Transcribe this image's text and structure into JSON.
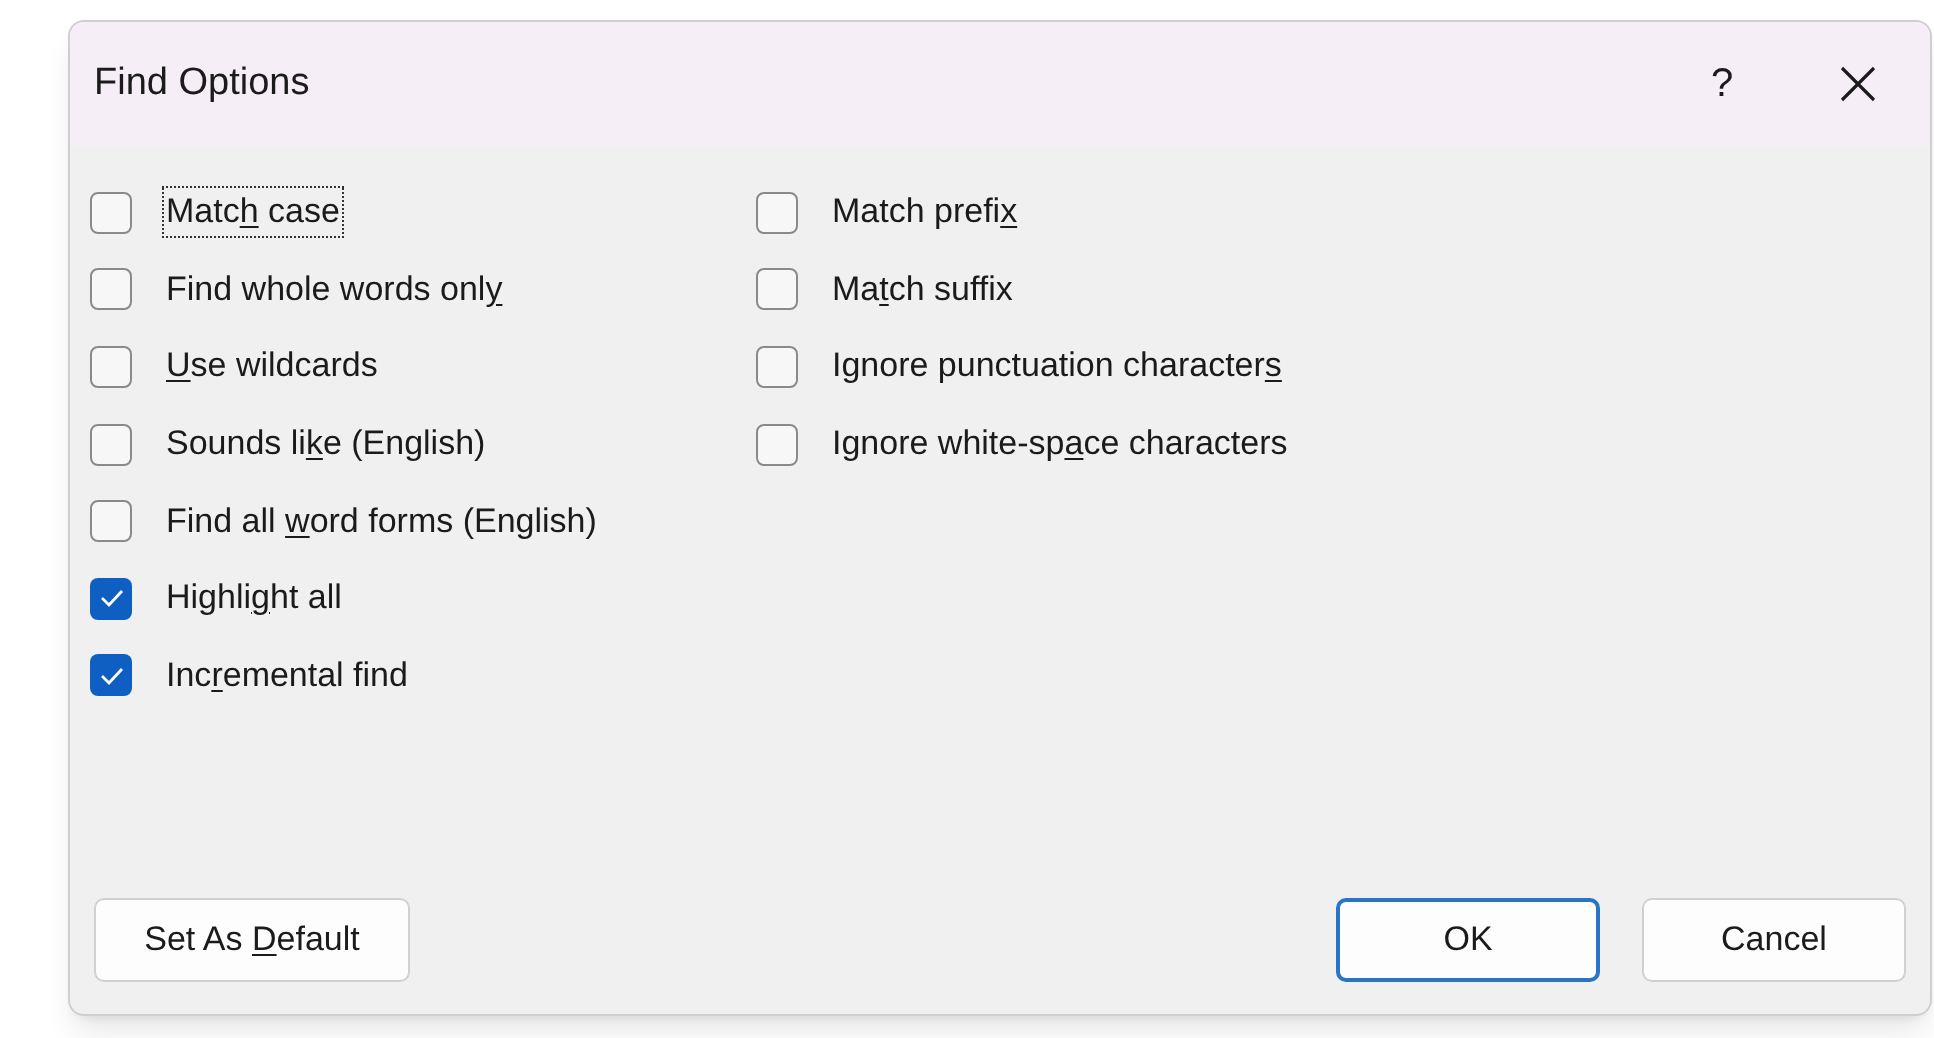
{
  "window": {
    "title": "Find Options",
    "help": "?"
  },
  "options_left": [
    {
      "before": "Matc",
      "key": "h",
      "after": " case",
      "checked": false,
      "focused": true
    },
    {
      "before": "Find whole words onl",
      "key": "y",
      "checked": false,
      "focused": false
    },
    {
      "key": "U",
      "after": "se wildcards",
      "checked": false,
      "focused": false
    },
    {
      "before": "Sounds li",
      "key": "k",
      "after": "e (English)",
      "checked": false,
      "focused": false
    },
    {
      "before": "Find all ",
      "key": "w",
      "after": "ord forms (English)",
      "checked": false,
      "focused": false
    },
    {
      "before": "Highli",
      "key": "g",
      "after": "ht all",
      "checked": true,
      "focused": false
    },
    {
      "before": "Inc",
      "key": "r",
      "after": "emental find",
      "checked": true,
      "focused": false
    }
  ],
  "options_right": [
    {
      "before": "Match prefi",
      "key": "x",
      "checked": false,
      "focused": false
    },
    {
      "before": "Ma",
      "key": "t",
      "after": "ch suffix",
      "checked": false,
      "focused": false
    },
    {
      "before": "Ignore punctuation character",
      "key": "s",
      "checked": false,
      "focused": false
    },
    {
      "before": "Ignore white-sp",
      "key": "a",
      "after": "ce characters",
      "checked": false,
      "focused": false
    }
  ],
  "buttons": [
    {
      "before": "Set As ",
      "key": "D",
      "after": "efault",
      "default": false
    },
    {
      "label": "OK",
      "default": true
    },
    {
      "label": "Cancel",
      "default": false
    }
  ]
}
